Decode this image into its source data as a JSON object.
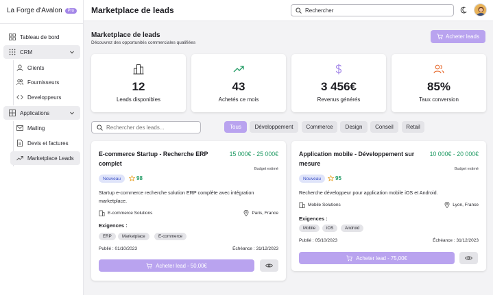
{
  "brand": {
    "name": "La Forge d'Avalon",
    "badge": "Pro"
  },
  "sidebar": {
    "dashboard": "Tableau de bord",
    "crm": "CRM",
    "clients": "Clients",
    "suppliers": "Fournisseurs",
    "developers": "Developpeurs",
    "applications": "Applications",
    "mailing": "Mailing",
    "invoices": "Devis et factures",
    "marketplace": "Marketplace Leads"
  },
  "header": {
    "title": "Marketplace de leads",
    "search_value": "Rechercher"
  },
  "main": {
    "title": "Marketplace de leads",
    "subtitle": "Découvrez des opportunités commerciales qualifiées",
    "buy_button": "Acheter leads"
  },
  "stats": [
    {
      "icon": "building-icon",
      "value": "12",
      "label": "Leads disponibles"
    },
    {
      "icon": "trending-up-icon",
      "value": "43",
      "label": "Achetés ce mois"
    },
    {
      "icon": "dollar-icon",
      "value": "3 456€",
      "label": "Revenus générés"
    },
    {
      "icon": "users-icon",
      "value": "85%",
      "label": "Taux conversion"
    }
  ],
  "filters": {
    "search_placeholder": "Rechercher des leads...",
    "chips": [
      "Tous",
      "Développement",
      "Commerce",
      "Design",
      "Conseil",
      "Retail"
    ],
    "selected": "Tous"
  },
  "leads": [
    {
      "title": "E-commerce Startup - Recherche ERP complet",
      "price": "15 000€ - 25 000€",
      "budget_label": "Budget estimé",
      "badge": "Nouveau",
      "score": "98",
      "description": "Startup e-commerce recherche solution ERP complète avec intégration marketplace.",
      "company": "E-commerce Solutions",
      "location": "Paris, France",
      "requirements_label": "Exigences :",
      "requirements": [
        "ERP",
        "Marketplace",
        "E-commerce"
      ],
      "published": "Publié : 01/10/2023",
      "deadline": "Échéance : 31/12/2023",
      "buy_label": "Acheter lead - 50,00€"
    },
    {
      "title": "Application mobile - Développement sur mesure",
      "price": "10 000€ - 20 000€",
      "budget_label": "Budget estimé",
      "badge": "Nouveau",
      "score": "95",
      "description": "Recherche développeur pour application mobile iOS et Android.",
      "company": "Mobile Solutions",
      "location": "Lyon, France",
      "requirements_label": "Exigences :",
      "requirements": [
        "Mobile",
        "iOS",
        "Android"
      ],
      "published": "Publié : 05/10/2023",
      "deadline": "Échéance : 31/12/2023",
      "buy_label": "Acheter lead - 75,00€"
    }
  ],
  "colors": {
    "accent": "#b9a3ef",
    "price": "#1f9a63",
    "badge_bg": "#dfe4fa",
    "badge_text": "#3b4fc4"
  }
}
